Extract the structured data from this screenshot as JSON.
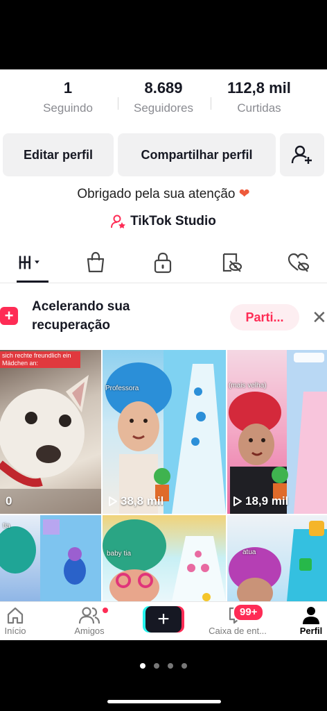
{
  "stats": {
    "following": {
      "value": "1",
      "label": "Seguindo"
    },
    "followers": {
      "value": "8.689",
      "label": "Seguidores"
    },
    "likes": {
      "value": "112,8 mil",
      "label": "Curtidas"
    }
  },
  "buttons": {
    "edit": "Editar perfil",
    "share": "Compartilhar perfil"
  },
  "bio": {
    "text": "Obrigado pela sua atenção",
    "emoji": "❤"
  },
  "studio": {
    "label": "TikTok Studio"
  },
  "tabs": [
    "videos-grid-icon",
    "shop-bag-icon",
    "lock-icon",
    "reposts-icon",
    "liked-icon"
  ],
  "banner": {
    "icon": "+",
    "title": "Acelerando sua recuperação",
    "action": "Parti...",
    "close": "✕"
  },
  "grid": {
    "tiles": [
      {
        "views": "0",
        "caption": "sich rechte freundlich ein Mädchen an:"
      },
      {
        "views": "38,8 mil",
        "caption": "Professora"
      },
      {
        "views": "18,9 mil",
        "caption": "(mais velha)"
      }
    ],
    "row2_captions": [
      "tia",
      "baby tia",
      "atua"
    ]
  },
  "nav": {
    "home": "Início",
    "friends": "Amigos",
    "create": "+",
    "inbox": "Caixa de ent...",
    "inbox_badge": "99+",
    "profile": "Perfil"
  },
  "colors": {
    "accent": "#fe2c55",
    "cyan": "#25f4ee",
    "text": "#161823"
  }
}
